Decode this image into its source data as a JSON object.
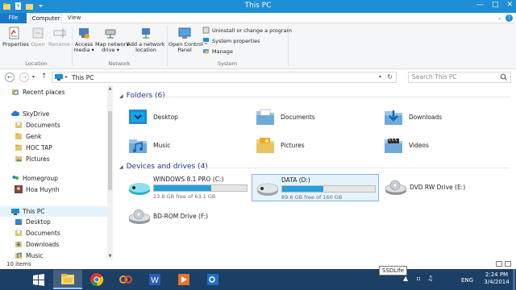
{
  "window": {
    "title": "This PC"
  },
  "ribbon": {
    "tabs": [
      {
        "label": "File"
      },
      {
        "label": "Computer"
      },
      {
        "label": "View"
      }
    ],
    "location": {
      "label": "Location",
      "buttons": [
        {
          "label": "Properties"
        },
        {
          "label": "Open"
        },
        {
          "label": "Rename"
        }
      ]
    },
    "network": {
      "label": "Network",
      "buttons": [
        {
          "label": "Access\nmedia ▾"
        },
        {
          "label": "Map network\ndrive ▾"
        },
        {
          "label": "Add a network\nlocation"
        }
      ]
    },
    "system": {
      "label": "System",
      "open_control_panel": "Open Control\nPanel",
      "small": [
        {
          "label": "Uninstall or change a program"
        },
        {
          "label": "System properties"
        },
        {
          "label": "Manage"
        }
      ]
    }
  },
  "address": {
    "crumb": "This PC",
    "search_placeholder": "Search This PC"
  },
  "navpane": {
    "items": [
      {
        "label": "Recent places",
        "icon": "recent-places-icon"
      },
      {
        "label": "SkyDrive",
        "icon": "cloud-icon"
      },
      {
        "label": "Documents",
        "icon": "documents-icon"
      },
      {
        "label": "Genk",
        "icon": "folder-icon"
      },
      {
        "label": "HOC TAP",
        "icon": "folder-icon"
      },
      {
        "label": "Pictures",
        "icon": "pictures-icon"
      },
      {
        "label": "Homegroup",
        "icon": "homegroup-icon"
      },
      {
        "label": "Hoa Huynh",
        "icon": "user-icon"
      },
      {
        "label": "This PC",
        "icon": "computer-icon"
      },
      {
        "label": "Desktop",
        "icon": "desktop-icon"
      },
      {
        "label": "Documents",
        "icon": "documents-icon"
      },
      {
        "label": "Downloads",
        "icon": "downloads-icon"
      },
      {
        "label": "Music",
        "icon": "music-icon"
      }
    ]
  },
  "folders": {
    "heading": "Folders (6)",
    "items": [
      {
        "label": "Desktop",
        "icon": "desktop-folder-icon"
      },
      {
        "label": "Documents",
        "icon": "documents-folder-icon"
      },
      {
        "label": "Downloads",
        "icon": "downloads-folder-icon"
      },
      {
        "label": "Music",
        "icon": "music-folder-icon"
      },
      {
        "label": "Pictures",
        "icon": "pictures-folder-icon"
      },
      {
        "label": "Videos",
        "icon": "videos-folder-icon"
      }
    ]
  },
  "drives": {
    "heading": "Devices and drives (4)",
    "items": [
      {
        "label": "WINDOWS 8.1 PRO (C:)",
        "free": "23.8 GB free of 63.1 GB",
        "used_fraction": 0.62
      },
      {
        "label": "DATA (D:)",
        "free": "89.6 GB free of 160 GB",
        "used_fraction": 0.44
      },
      {
        "label": "DVD RW Drive (E:)"
      },
      {
        "label": "BD-ROM Drive (F:)"
      }
    ]
  },
  "status": {
    "count": "10 items"
  },
  "taskbar": {
    "tooltip": "SSDLife",
    "lang": "ENG",
    "time": "2:24 PM",
    "date": "3/4/2014"
  },
  "colors": {
    "accent": "#1e8fd6",
    "file_tab": "#1979ca",
    "drive_bar": "#26a0da",
    "taskbar": "#1c3f66",
    "group_heading": "#1e3287"
  }
}
